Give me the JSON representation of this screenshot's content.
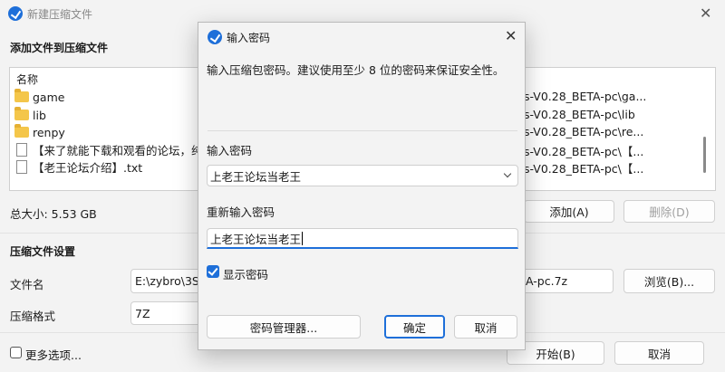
{
  "main": {
    "title": "新建压缩文件",
    "add_section": "添加文件到压缩文件",
    "list_header": "名称",
    "files": [
      {
        "name": "game",
        "type": "folder",
        "path": "s-V0.28_BETA-pc\\ga..."
      },
      {
        "name": "lib",
        "type": "folder",
        "path": "s-V0.28_BETA-pc\\lib"
      },
      {
        "name": "renpy",
        "type": "folder",
        "path": "s-V0.28_BETA-pc\\re..."
      },
      {
        "name": "【来了就能下载和观看的论坛，纯",
        "type": "file",
        "path": "s-V0.28_BETA-pc\\【..."
      },
      {
        "name": "【老王论坛介绍】.txt",
        "type": "file",
        "path": "s-V0.28_BETA-pc\\【..."
      }
    ],
    "total_size": "总大小: 5.53 GB",
    "add_button": "添加(A)",
    "delete_button": "删除(D)",
    "settings_section": "压缩文件设置",
    "filename_label": "文件名",
    "filename_value": "E:\\zybro\\3S",
    "filename_tail": "A-pc.7z",
    "browse_button": "浏览(B)...",
    "format_label": "压缩格式",
    "format_value": "7Z",
    "more_options": "更多选项...",
    "start_button": "开始(B)",
    "cancel_button": "取消"
  },
  "dialog": {
    "title": "输入密码",
    "instruction": "输入压缩包密码。建议使用至少 8 位的密码来保证安全性。",
    "password_label": "输入密码",
    "password_value": "上老王论坛当老王",
    "reenter_label": "重新输入密码",
    "reenter_value": "上老王论坛当老王",
    "show_password": "显示密码",
    "show_password_checked": true,
    "manager_button": "密码管理器...",
    "ok_button": "确定",
    "cancel_button": "取消"
  },
  "colors": {
    "accent": "#1e6fd9",
    "folder": "#f4c64a"
  }
}
